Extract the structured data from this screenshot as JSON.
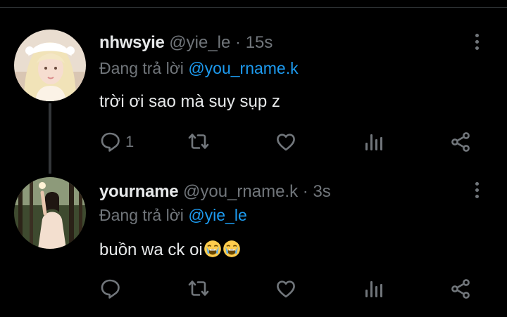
{
  "colors": {
    "background": "#000000",
    "text": "#e7e9ea",
    "muted": "#71767b",
    "mention": "#1d9bf0",
    "thread_line": "#333639"
  },
  "replying_prefix": "Đang trả lời",
  "tweets": [
    {
      "display_name": "nhwsyie",
      "handle": "@yie_le",
      "separator": "·",
      "time": "15s",
      "replying_to": "@you_rname.k",
      "text": "trời ơi sao mà suy sụp z",
      "emojis": [],
      "reply_count": "1",
      "icons": [
        "reply-icon",
        "retweet-icon",
        "like-icon",
        "analytics-icon",
        "share-icon",
        "more-icon"
      ]
    },
    {
      "display_name": "yourname",
      "handle": "@you_rname.k",
      "separator": "·",
      "time": "3s",
      "replying_to": "@yie_le",
      "text": "buồn wa ck oi",
      "emojis": [
        "loudly-crying-face",
        "loudly-crying-face"
      ],
      "reply_count": "",
      "icons": [
        "reply-icon",
        "retweet-icon",
        "like-icon",
        "analytics-icon",
        "share-icon",
        "more-icon"
      ]
    }
  ]
}
